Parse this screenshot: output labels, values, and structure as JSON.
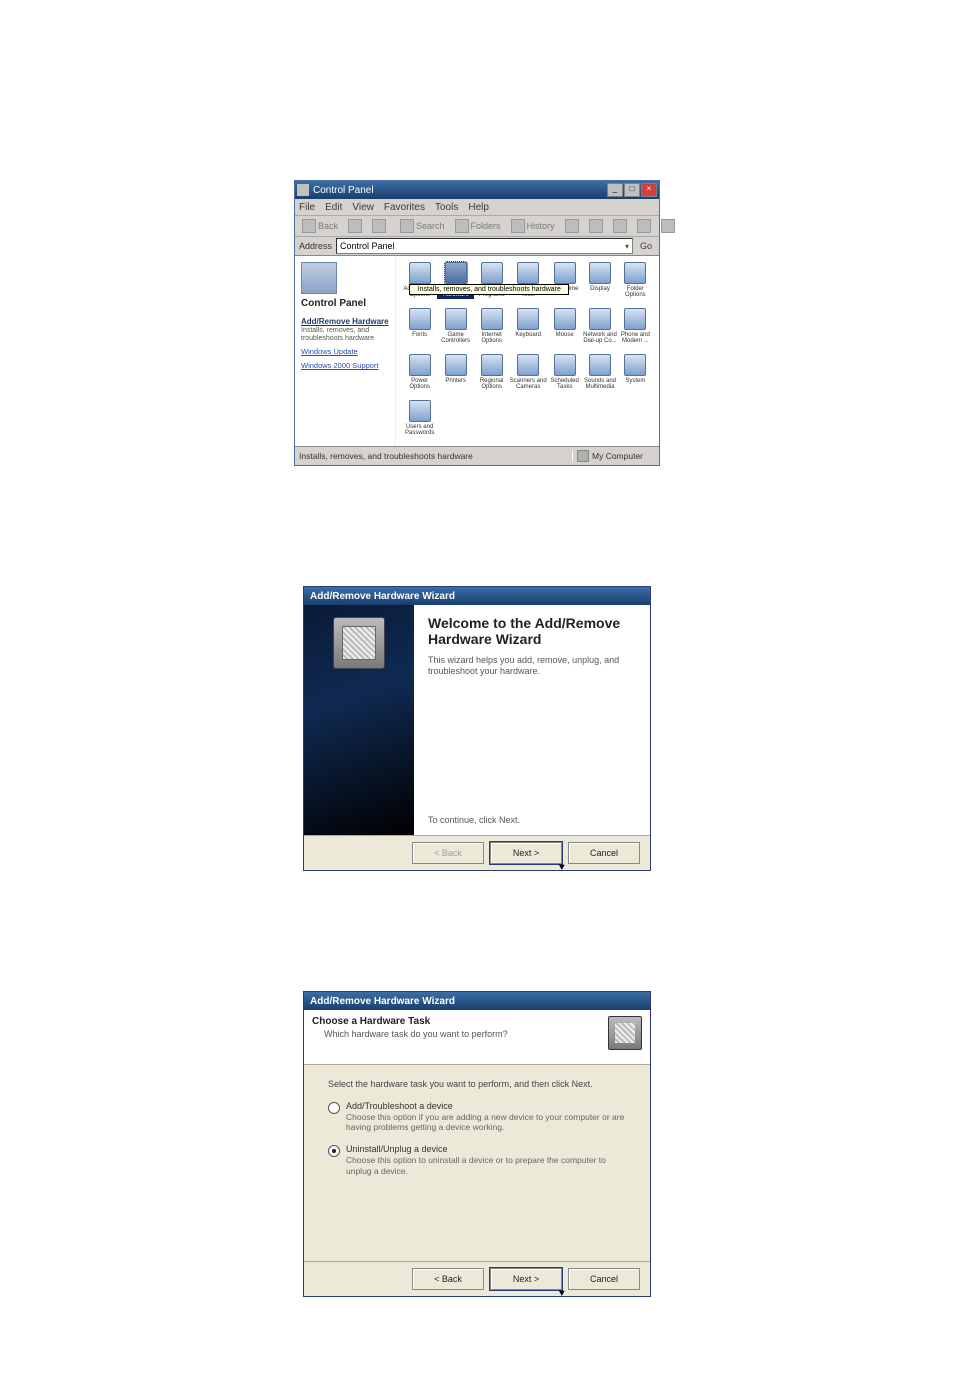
{
  "control_panel": {
    "title_text": "Control Panel",
    "menu": [
      "File",
      "Edit",
      "View",
      "Favorites",
      "Tools",
      "Help"
    ],
    "toolbar": {
      "back": "Back",
      "search": "Search",
      "folders": "Folders",
      "history": "History"
    },
    "address_label": "Address",
    "address_value": "Control Panel",
    "go_label": "Go",
    "left": {
      "panel_title": "Control Panel",
      "headline": "Add/Remove Hardware",
      "headline_desc": "Installs, removes, and troubleshoots hardware",
      "link1": "Windows Update",
      "link2": "Windows 2000 Support"
    },
    "icons": [
      {
        "label": "Accessibility Options",
        "kind": "access-icon"
      },
      {
        "label": "Add/Remove Hardware",
        "kind": "hardware-icon",
        "selected": true
      },
      {
        "label": "Add/Remove Programs",
        "kind": "programs-icon"
      },
      {
        "label": "Administrative Tools",
        "kind": "admin-icon"
      },
      {
        "label": "Date/Time",
        "kind": "date-icon"
      },
      {
        "label": "Display",
        "kind": "display-icon"
      },
      {
        "label": "Folder Options",
        "kind": "folder-icon"
      },
      {
        "label": "Fonts",
        "kind": "fonts-icon"
      },
      {
        "label": "Game Controllers",
        "kind": "game-icon"
      },
      {
        "label": "Internet Options",
        "kind": "internet-icon"
      },
      {
        "label": "Keyboard",
        "kind": "keyboard-icon"
      },
      {
        "label": "Mouse",
        "kind": "mouse-icon"
      },
      {
        "label": "Network and Dial-up Co...",
        "kind": "network-icon"
      },
      {
        "label": "Phone and Modem ...",
        "kind": "phone-icon"
      },
      {
        "label": "Power Options",
        "kind": "power-icon"
      },
      {
        "label": "Printers",
        "kind": "printers-icon"
      },
      {
        "label": "Regional Options",
        "kind": "regional-icon"
      },
      {
        "label": "Scanners and Cameras",
        "kind": "scanner-icon"
      },
      {
        "label": "Scheduled Tasks",
        "kind": "tasks-icon"
      },
      {
        "label": "Sounds and Multimedia",
        "kind": "sounds-icon"
      },
      {
        "label": "System",
        "kind": "system-icon"
      },
      {
        "label": "Users and Passwords",
        "kind": "users-icon"
      }
    ],
    "tooltip": "Installs, removes, and troubleshoots hardware",
    "status_left": "Installs, removes, and troubleshoots hardware",
    "status_right": "My Computer"
  },
  "wizard1": {
    "title": "Add/Remove Hardware Wizard",
    "heading": "Welcome to the Add/Remove Hardware Wizard",
    "desc": "This wizard helps you add, remove, unplug, and troubleshoot your hardware.",
    "continue": "To continue, click Next.",
    "back": "< Back",
    "next": "Next >",
    "cancel": "Cancel"
  },
  "wizard2": {
    "title": "Add/Remove Hardware Wizard",
    "header_title": "Choose a Hardware Task",
    "header_sub": "Which hardware task do you want to perform?",
    "instruction": "Select the hardware task you want to perform, and then click Next.",
    "opt1_title": "Add/Troubleshoot a device",
    "opt1_desc": "Choose this option if you are adding a new device to your computer or are having problems getting a device working.",
    "opt2_title": "Uninstall/Unplug a device",
    "opt2_desc": "Choose this option to uninstall a device or to prepare the computer to unplug a device.",
    "selected": "opt2",
    "back": "< Back",
    "next": "Next >",
    "cancel": "Cancel"
  }
}
